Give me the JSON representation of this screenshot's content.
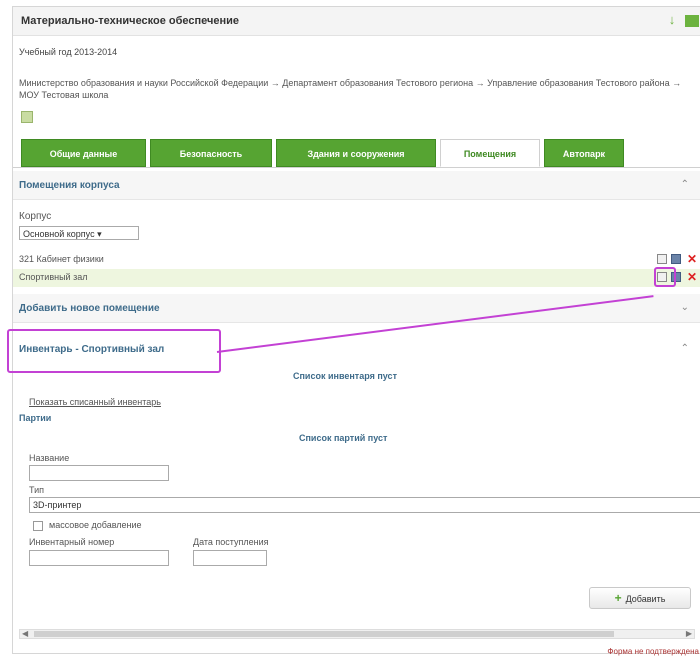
{
  "window": {
    "title": "Материально-техническое обеспечение"
  },
  "year": "Учебный год 2013-2014",
  "org_path": "Министерство образования и науки Российской Федерации → Департамент образования Тестового региона → Управление образования Тестового района → МОУ Тестовая школа",
  "tabs": [
    {
      "label": "Общие данные"
    },
    {
      "label": "Безопасность"
    },
    {
      "label": "Здания и сооружения"
    },
    {
      "label": "Помещения"
    },
    {
      "label": "Автопарк"
    }
  ],
  "rooms_section": {
    "title": "Помещения корпуса",
    "korpus_label": "Корпус",
    "korpus_value": "Основной корпус",
    "rooms": [
      "321 Кабинет физики",
      "Спортивный зал"
    ]
  },
  "add_room_section": {
    "title": "Добавить новое помещение"
  },
  "inventory_section": {
    "title": "Инвентарь - Спортивный зал",
    "empty_inventory": "Список инвентаря пуст",
    "show_written_off_link": "Показать списанный инвентарь",
    "batches_label": "Партии",
    "empty_batches": "Список партий пуст",
    "name_label": "Название",
    "type_label": "Тип",
    "type_value": "3D-принтер",
    "mass_add_label": "массовое добавление",
    "inv_number_label": "Инвентарный номер",
    "date_label": "Дата поступления",
    "add_button_label": "Добавить"
  },
  "footer_text": "Форма не подтверждена"
}
